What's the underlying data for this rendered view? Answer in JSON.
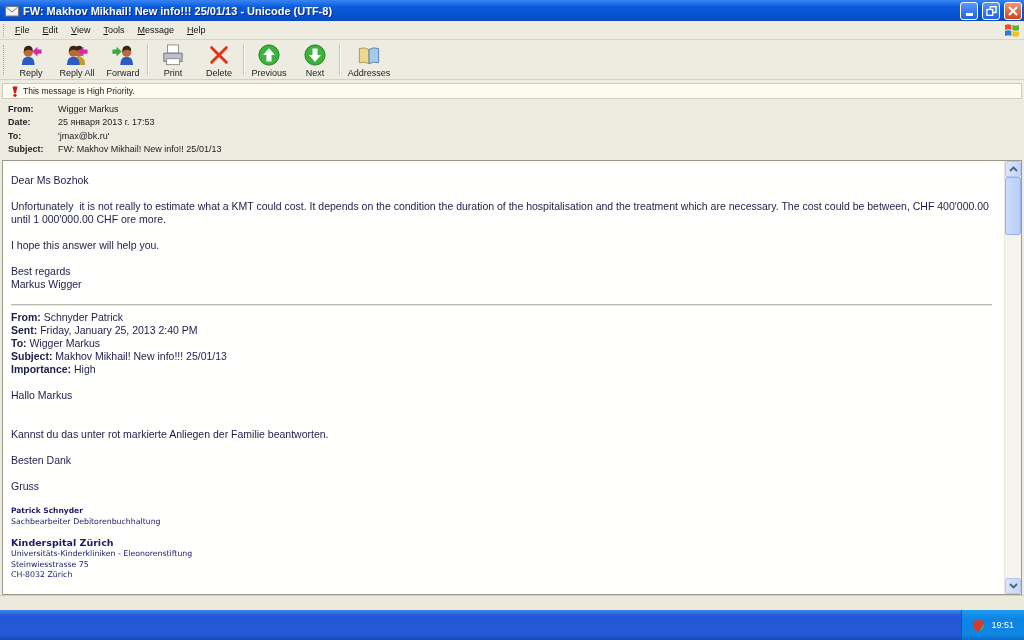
{
  "window": {
    "title": "FW: Makhov Mikhail! New info!!! 25/01/13 - Unicode (UTF-8)"
  },
  "menu": [
    "File",
    "Edit",
    "View",
    "Tools",
    "Message",
    "Help"
  ],
  "toolbar": [
    {
      "buttons": [
        {
          "kind": "reply",
          "label": "Reply"
        },
        {
          "kind": "reply_all",
          "label": "Reply All"
        },
        {
          "kind": "forward",
          "label": "Forward"
        }
      ]
    },
    {
      "buttons": [
        {
          "kind": "print",
          "label": "Print"
        },
        {
          "kind": "delete",
          "label": "Delete"
        }
      ]
    },
    {
      "buttons": [
        {
          "kind": "previous",
          "label": "Previous"
        },
        {
          "kind": "next",
          "label": "Next"
        }
      ]
    },
    {
      "buttons": [
        {
          "kind": "addresses",
          "label": "Addresses"
        }
      ]
    }
  ],
  "priority_notice": "This message is High Priority.",
  "headers": [
    {
      "label": "From:",
      "value": "Wigger Markus"
    },
    {
      "label": "Date:",
      "value": "25 января 2013 г. 17:53"
    },
    {
      "label": "To:",
      "value": "'jmax@bk.ru'"
    },
    {
      "label": "Subject:",
      "value": "FW: Makhov Mikhail! New info!! 25/01/13"
    }
  ],
  "body": {
    "reply": [
      {
        "kind": "text",
        "lines": [
          "Dear Ms Bozhok"
        ]
      },
      {
        "kind": "text",
        "lines": [
          "Unfortunately  it is not really to estimate what a KMT could cost. It depends on the condition the duration of the hospitalisation and the treatment which are necessary. The cost could be between, CHF 400'000.00 until 1 000'000.00 CHF ore more."
        ]
      },
      {
        "kind": "text",
        "lines": [
          "I hope this answer will help you."
        ]
      },
      {
        "kind": "text",
        "lines": [
          "Best regards",
          "Markus Wigger"
        ]
      }
    ],
    "original_headers": [
      {
        "label": "From:",
        "value": "Schnyder Patrick"
      },
      {
        "label": "Sent:",
        "value": "Friday, January 25, 2013 2:40 PM"
      },
      {
        "label": "To:",
        "value": "Wigger Markus"
      },
      {
        "label": "Subject:",
        "value": "Makhov Mikhail! New info!!! 25/01/13"
      },
      {
        "label": "Importance:",
        "value": "High"
      }
    ],
    "original": [
      {
        "kind": "greeting",
        "lines": [
          "Hallo Markus"
        ]
      },
      {
        "kind": "text",
        "lines": [
          "Kannst du das unter rot markierte Anliegen der Familie beantworten."
        ]
      },
      {
        "kind": "text",
        "lines": [
          "Besten Dank"
        ]
      },
      {
        "kind": "text",
        "lines": [
          "Gruss"
        ]
      }
    ],
    "signature": {
      "name": "Patrick Schnyder",
      "role": "Sachbearbeiter Debitorenbuchhaltung",
      "organization": "Kinderspital Zürich",
      "address": [
        "Universitäts-Kinderkliniken - Eleonorenstiftung",
        "Steinwiesstrasse 75",
        "CH-8032 Zürich"
      ]
    }
  },
  "taskbar": {
    "clock": "19:51"
  }
}
